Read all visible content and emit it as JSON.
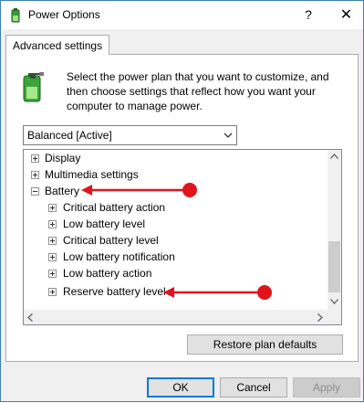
{
  "window": {
    "title": "Power Options",
    "help_glyph": "?",
    "close_glyph": "✕"
  },
  "tab": {
    "label": "Advanced settings"
  },
  "description": "Select the power plan that you want to customize, and then choose settings that reflect how you want your computer to manage power.",
  "plan_select": {
    "value": "Balanced [Active]"
  },
  "tree": {
    "items": [
      {
        "label": "Display",
        "expander": "plus"
      },
      {
        "label": "Multimedia settings",
        "expander": "plus"
      },
      {
        "label": "Battery",
        "expander": "minus"
      },
      {
        "label": "Critical battery action",
        "expander": "plus"
      },
      {
        "label": "Low battery level",
        "expander": "plus"
      },
      {
        "label": "Critical battery level",
        "expander": "plus"
      },
      {
        "label": "Low battery notification",
        "expander": "plus"
      },
      {
        "label": "Low battery action",
        "expander": "plus"
      },
      {
        "label": "Reserve battery level",
        "expander": "plus"
      }
    ]
  },
  "buttons": {
    "restore": "Restore plan defaults",
    "ok": "OK",
    "cancel": "Cancel",
    "apply": "Apply"
  },
  "colors": {
    "annotation_red": "#e1141c",
    "focus_blue": "#0078d7"
  },
  "icons": {
    "app": "power-options-icon",
    "battery": "battery-plug-icon"
  }
}
